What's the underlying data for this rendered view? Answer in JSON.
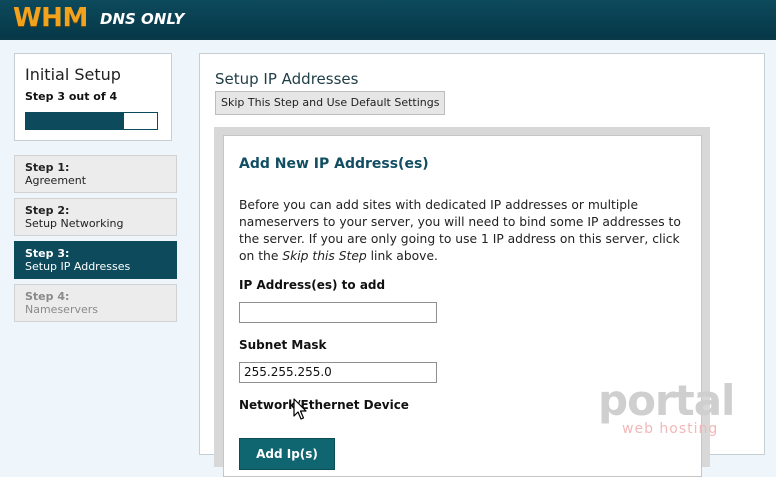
{
  "header": {
    "logo": "WHM",
    "edition": "DNS ONLY"
  },
  "sidebar": {
    "title": "Initial Setup",
    "step_of": "Step 3 out of 4",
    "progress_fraction": 0.75,
    "steps": [
      {
        "num": "Step 1:",
        "label": "Agreement",
        "state": "done"
      },
      {
        "num": "Step 2:",
        "label": "Setup Networking",
        "state": "done"
      },
      {
        "num": "Step 3:",
        "label": "Setup IP Addresses",
        "state": "active"
      },
      {
        "num": "Step 4:",
        "label": "Nameservers",
        "state": "disabled"
      }
    ]
  },
  "main": {
    "title": "Setup IP Addresses",
    "skip_button": "Skip This Step and Use Default Settings",
    "form": {
      "title": "Add New IP Address(es)",
      "desc_before": "Before you can add sites with dedicated IP addresses or multiple nameservers to your server, you will need to bind some IP addresses to the server. If you are only going to use 1 IP address on this server, click on the ",
      "desc_link": "Skip this Step",
      "desc_after": " link above.",
      "ip_label": "IP Address(es) to add",
      "ip_value": "",
      "subnet_label": "Subnet Mask",
      "subnet_value": "255.255.255.0",
      "device_label": "Network/Ethernet Device",
      "add_button": "Add Ip(s)"
    }
  },
  "watermark": {
    "brand": "portal",
    "tagline": "web hosting"
  }
}
